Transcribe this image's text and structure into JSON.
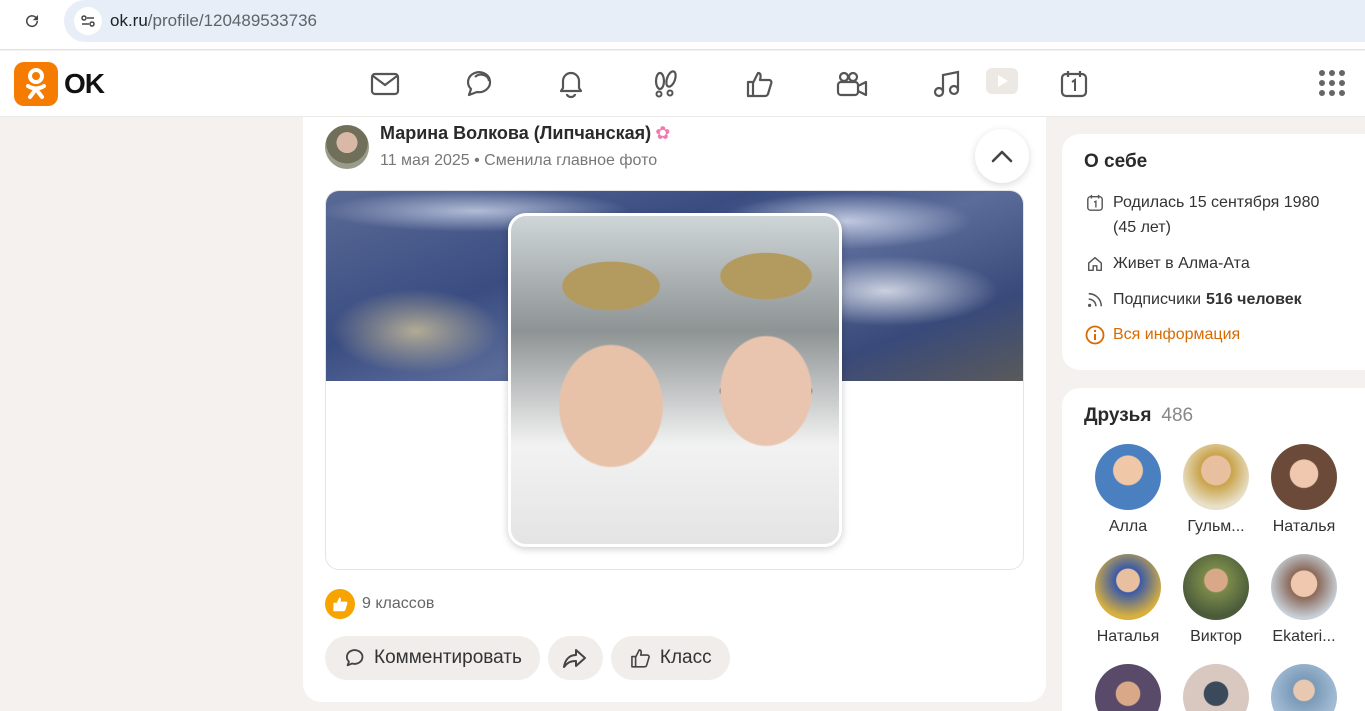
{
  "browser": {
    "url_host": "ok.ru",
    "url_path": "/profile/120489533736"
  },
  "header": {
    "logo_text": "OK",
    "brand_color": "#f57c00",
    "nav_icons": [
      "messages-icon",
      "discussions-icon",
      "notifications-icon",
      "guests-icon",
      "reactions-icon",
      "video-calls-icon",
      "music-icon",
      "video-icon",
      "calendar-icon"
    ]
  },
  "post": {
    "author_name": "Марина Волкова (Липчанская)",
    "date": "11 мая 2025",
    "separator": "•",
    "action": "Сменила главное фото",
    "likes_text": "9 классов",
    "buttons": {
      "comment": "Комментировать",
      "like": "Класс"
    }
  },
  "about": {
    "title": "О себе",
    "birthday": "Родилась 15 сентября 1980",
    "age": "(45 лет)",
    "lives": "Живет в Алма-Ата",
    "followers_label": "Подписчики",
    "followers_count": "516 человек",
    "all_info": "Вся информация",
    "accent_color": "#d86b00"
  },
  "friends": {
    "title": "Друзья",
    "count": "486",
    "items": [
      {
        "name": "Алла",
        "color": "#4a7fc0"
      },
      {
        "name": "Гульм...",
        "color": "#c9a34a"
      },
      {
        "name": "Наталья",
        "color": "#6b4a3a"
      },
      {
        "name": "Наталья",
        "color": "#3a5aa8"
      },
      {
        "name": "Виктор",
        "color": "#7a8a4a"
      },
      {
        "name": "Ekateri...",
        "color": "#8a6a5a"
      },
      {
        "name": "",
        "color": "#5a4a6a"
      },
      {
        "name": "",
        "color": "#d8c8c0"
      },
      {
        "name": "",
        "color": "#7a9ab8"
      }
    ]
  }
}
